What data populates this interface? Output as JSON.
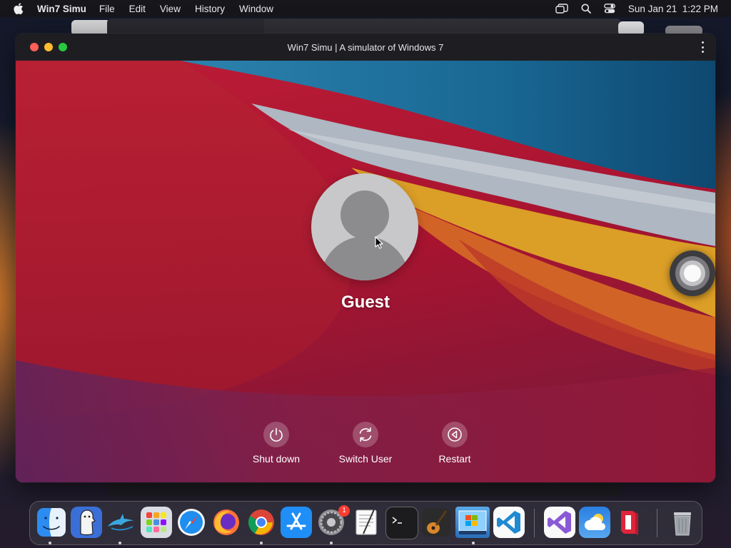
{
  "menubar": {
    "apple_icon": "apple-logo-icon",
    "app_name": "Win7 Simu",
    "menus": [
      "File",
      "Edit",
      "View",
      "History",
      "Window"
    ],
    "status_icons": [
      "stage-manager-icon",
      "spotlight-search-icon",
      "control-center-icon"
    ],
    "datetime": "Sun Jan 21  1:22 PM"
  },
  "window": {
    "title": "Win7 Simu | A simulator of Windows 7",
    "traffic_lights": [
      "close",
      "minimize",
      "zoom"
    ],
    "colors": {
      "close": "#fe5f57",
      "minimize": "#febc2e",
      "zoom": "#28c840"
    }
  },
  "login": {
    "user_name": "Guest",
    "avatar_icon": "default-user-icon",
    "buttons": [
      {
        "label": "Shut down",
        "icon": "power-icon"
      },
      {
        "label": "Switch User",
        "icon": "refresh-icon"
      },
      {
        "label": "Restart",
        "icon": "restart-icon"
      }
    ]
  },
  "dock": {
    "apps": [
      {
        "name": "Finder",
        "icon": "finder-icon",
        "running": true
      },
      {
        "name": "Ghost Buster",
        "icon": "ghost-app-icon",
        "running": true
      },
      {
        "name": "Dolphin",
        "icon": "dolphin-icon",
        "running": true
      },
      {
        "name": "Launchpad",
        "icon": "launchpad-icon",
        "running": false
      },
      {
        "name": "Safari",
        "icon": "safari-icon",
        "running": false
      },
      {
        "name": "Firefox",
        "icon": "firefox-icon",
        "running": false
      },
      {
        "name": "Chrome",
        "icon": "chrome-icon",
        "running": true
      },
      {
        "name": "App Store",
        "icon": "app-store-icon",
        "running": false
      },
      {
        "name": "System Settings",
        "icon": "system-settings-icon",
        "running": true,
        "badge": "1"
      },
      {
        "name": "TextEdit",
        "icon": "textedit-icon",
        "running": false
      },
      {
        "name": "Terminal",
        "icon": "terminal-icon",
        "running": false
      },
      {
        "name": "GarageBand",
        "icon": "garageband-icon",
        "running": false
      },
      {
        "name": "Win7 Simu",
        "icon": "win7-simu-icon",
        "running": true
      },
      {
        "name": "Visual Studio Code",
        "icon": "vscode-icon",
        "running": false
      },
      {
        "name": "Visual Studio",
        "icon": "visual-studio-icon",
        "running": false
      },
      {
        "name": "Weather",
        "icon": "weather-icon",
        "running": false
      },
      {
        "name": "Parallels",
        "icon": "parallels-icon",
        "running": false
      },
      {
        "name": "Trash",
        "icon": "trash-icon",
        "running": false
      }
    ],
    "separators_after": [
      13,
      16
    ]
  }
}
